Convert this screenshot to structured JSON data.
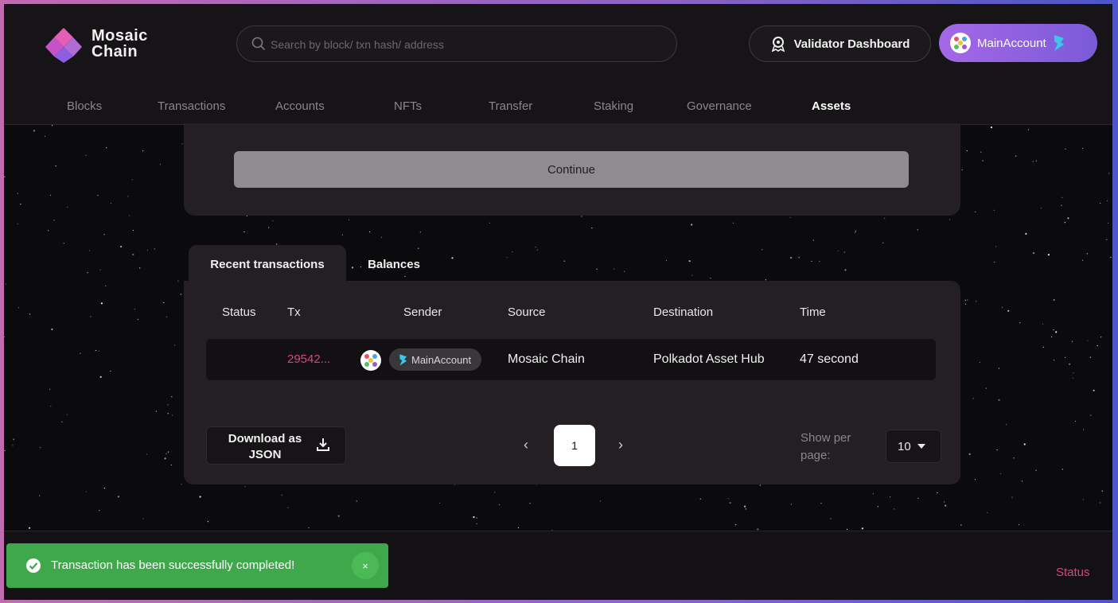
{
  "brand": {
    "line1": "Mosaic",
    "line2": "Chain"
  },
  "search": {
    "placeholder": "Search by block/ txn hash/ address"
  },
  "header": {
    "validator_label": "Validator Dashboard",
    "account_label": "MainAccount"
  },
  "nav": {
    "items": [
      {
        "label": "Blocks"
      },
      {
        "label": "Transactions"
      },
      {
        "label": "Accounts"
      },
      {
        "label": "NFTs"
      },
      {
        "label": "Transfer"
      },
      {
        "label": "Staking"
      },
      {
        "label": "Governance"
      },
      {
        "label": "Assets",
        "active": true
      }
    ]
  },
  "form": {
    "continue_label": "Continue"
  },
  "tabs": [
    {
      "label": "Recent transactions",
      "active": true
    },
    {
      "label": "Balances"
    }
  ],
  "table": {
    "columns": [
      "Status",
      "Tx",
      "Sender",
      "Source",
      "Destination",
      "Time"
    ],
    "rows": [
      {
        "status": "",
        "tx": "29542...",
        "sender": "MainAccount",
        "source": "Mosaic Chain",
        "destination": "Polkadot Asset Hub",
        "time": "47 second"
      }
    ]
  },
  "pagination": {
    "download_label": "Download as JSON",
    "prev": "‹",
    "current_page": "1",
    "next": "›",
    "per_page_label": "Show per page:",
    "per_page_value": "10"
  },
  "toast": {
    "message": "Transaction has been successfully completed!",
    "close": "×"
  },
  "footer": {
    "status_label": "Status"
  },
  "colors": {
    "accent": "#d24a7a",
    "account_gradient_start": "#a468e6",
    "success": "#3fa84b",
    "background": "#141114"
  }
}
